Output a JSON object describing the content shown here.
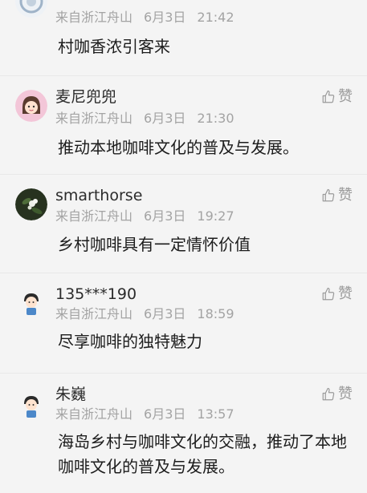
{
  "comments": [
    {
      "username": "",
      "location": "来自浙江舟山",
      "date": "6月3日",
      "time": "21:42",
      "content": "村咖香浓引客来",
      "like_label": "",
      "avatar": "blue-pattern-avatar"
    },
    {
      "username": "麦尼兜兜",
      "location": "来自浙江舟山",
      "date": "6月3日",
      "time": "21:30",
      "content": "推动本地咖啡文化的普及与发展。",
      "like_label": "赞",
      "avatar": "cartoon-girl-avatar"
    },
    {
      "username": "smarthorse",
      "location": "来自浙江舟山",
      "date": "6月3日",
      "time": "19:27",
      "content": "乡村咖啡具有一定情怀价值",
      "like_label": "赞",
      "avatar": "flower-photo-avatar"
    },
    {
      "username": "135***190",
      "location": "来自浙江舟山",
      "date": "6月3日",
      "time": "18:59",
      "content": "尽享咖啡的独特魅力",
      "like_label": "赞",
      "avatar": "cartoon-boy-avatar"
    },
    {
      "username": "朱巍",
      "location": "来自浙江舟山",
      "date": "6月3日",
      "time": "13:57",
      "content": "海岛乡村与咖啡文化的交融，推动了本地咖啡文化的普及与发展。",
      "like_label": "赞",
      "avatar": "cartoon-boy-avatar"
    }
  ],
  "colors": {
    "background": "#f4f4f4",
    "username": "#2b2b2b",
    "meta": "#a3a3a3",
    "content": "#1c1c1c",
    "like": "#9a9a9a"
  }
}
